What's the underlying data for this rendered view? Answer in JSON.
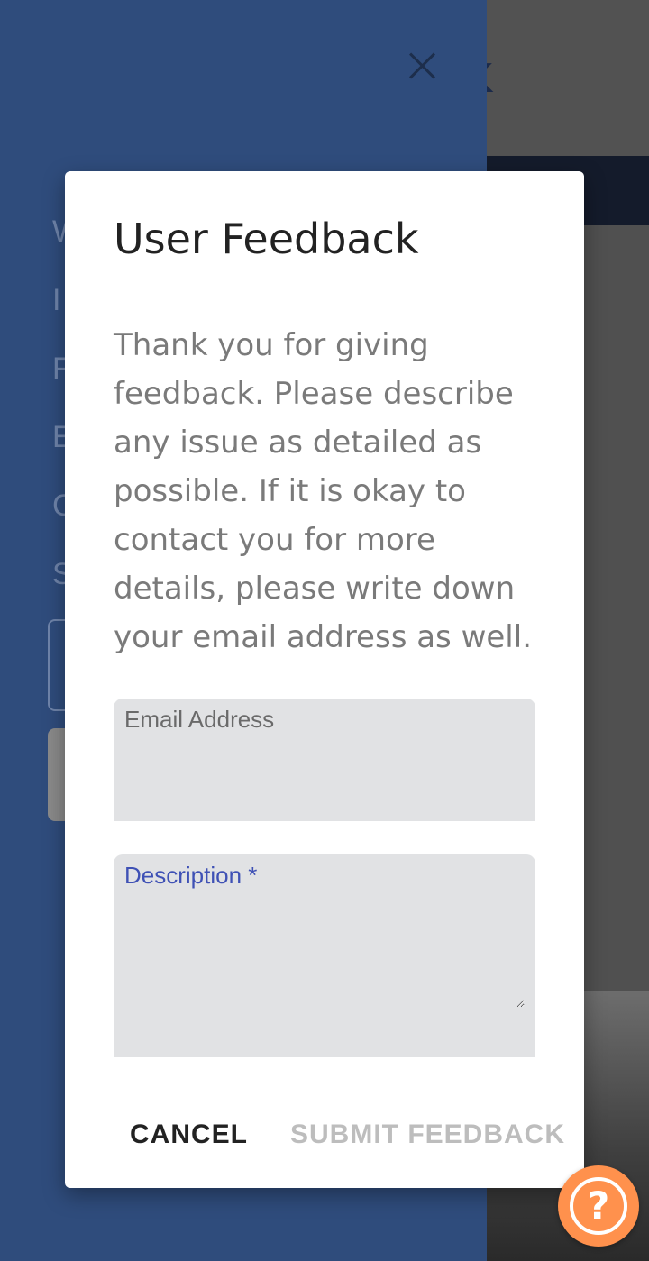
{
  "background": {
    "logo_fragment": "K"
  },
  "drawer": {
    "nav_items": [
      "W",
      "I",
      "F",
      "E",
      "C",
      "S"
    ]
  },
  "dialog": {
    "title": "User Feedback",
    "body": "Thank you for giving feedback. Please describe any issue as detailed as possible. If it is okay to contact you for more details, please write down your email address as well.",
    "email": {
      "label": "Email Address",
      "value": ""
    },
    "description": {
      "label": "Description *",
      "value": ""
    },
    "cancel_label": "CANCEL",
    "submit_label": "SUBMIT FEEDBACK"
  },
  "fab": {
    "symbol": "?"
  },
  "colors": {
    "drawer": "#2f4c7c",
    "accent_label": "#3f51b5",
    "fab": "#ff914d",
    "disabled_text": "#bdbdbd"
  }
}
